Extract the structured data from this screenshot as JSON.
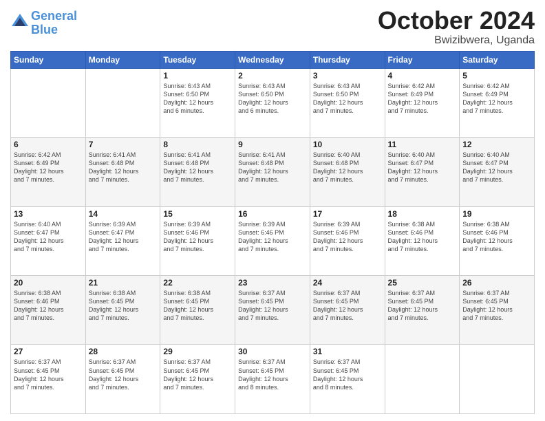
{
  "header": {
    "logo_line1": "General",
    "logo_line2": "Blue",
    "month": "October 2024",
    "location": "Bwizibwera, Uganda"
  },
  "weekdays": [
    "Sunday",
    "Monday",
    "Tuesday",
    "Wednesday",
    "Thursday",
    "Friday",
    "Saturday"
  ],
  "weeks": [
    [
      {
        "day": "",
        "info": ""
      },
      {
        "day": "",
        "info": ""
      },
      {
        "day": "1",
        "info": "Sunrise: 6:43 AM\nSunset: 6:50 PM\nDaylight: 12 hours\nand 6 minutes."
      },
      {
        "day": "2",
        "info": "Sunrise: 6:43 AM\nSunset: 6:50 PM\nDaylight: 12 hours\nand 6 minutes."
      },
      {
        "day": "3",
        "info": "Sunrise: 6:43 AM\nSunset: 6:50 PM\nDaylight: 12 hours\nand 7 minutes."
      },
      {
        "day": "4",
        "info": "Sunrise: 6:42 AM\nSunset: 6:49 PM\nDaylight: 12 hours\nand 7 minutes."
      },
      {
        "day": "5",
        "info": "Sunrise: 6:42 AM\nSunset: 6:49 PM\nDaylight: 12 hours\nand 7 minutes."
      }
    ],
    [
      {
        "day": "6",
        "info": "Sunrise: 6:42 AM\nSunset: 6:49 PM\nDaylight: 12 hours\nand 7 minutes."
      },
      {
        "day": "7",
        "info": "Sunrise: 6:41 AM\nSunset: 6:48 PM\nDaylight: 12 hours\nand 7 minutes."
      },
      {
        "day": "8",
        "info": "Sunrise: 6:41 AM\nSunset: 6:48 PM\nDaylight: 12 hours\nand 7 minutes."
      },
      {
        "day": "9",
        "info": "Sunrise: 6:41 AM\nSunset: 6:48 PM\nDaylight: 12 hours\nand 7 minutes."
      },
      {
        "day": "10",
        "info": "Sunrise: 6:40 AM\nSunset: 6:48 PM\nDaylight: 12 hours\nand 7 minutes."
      },
      {
        "day": "11",
        "info": "Sunrise: 6:40 AM\nSunset: 6:47 PM\nDaylight: 12 hours\nand 7 minutes."
      },
      {
        "day": "12",
        "info": "Sunrise: 6:40 AM\nSunset: 6:47 PM\nDaylight: 12 hours\nand 7 minutes."
      }
    ],
    [
      {
        "day": "13",
        "info": "Sunrise: 6:40 AM\nSunset: 6:47 PM\nDaylight: 12 hours\nand 7 minutes."
      },
      {
        "day": "14",
        "info": "Sunrise: 6:39 AM\nSunset: 6:47 PM\nDaylight: 12 hours\nand 7 minutes."
      },
      {
        "day": "15",
        "info": "Sunrise: 6:39 AM\nSunset: 6:46 PM\nDaylight: 12 hours\nand 7 minutes."
      },
      {
        "day": "16",
        "info": "Sunrise: 6:39 AM\nSunset: 6:46 PM\nDaylight: 12 hours\nand 7 minutes."
      },
      {
        "day": "17",
        "info": "Sunrise: 6:39 AM\nSunset: 6:46 PM\nDaylight: 12 hours\nand 7 minutes."
      },
      {
        "day": "18",
        "info": "Sunrise: 6:38 AM\nSunset: 6:46 PM\nDaylight: 12 hours\nand 7 minutes."
      },
      {
        "day": "19",
        "info": "Sunrise: 6:38 AM\nSunset: 6:46 PM\nDaylight: 12 hours\nand 7 minutes."
      }
    ],
    [
      {
        "day": "20",
        "info": "Sunrise: 6:38 AM\nSunset: 6:46 PM\nDaylight: 12 hours\nand 7 minutes."
      },
      {
        "day": "21",
        "info": "Sunrise: 6:38 AM\nSunset: 6:45 PM\nDaylight: 12 hours\nand 7 minutes."
      },
      {
        "day": "22",
        "info": "Sunrise: 6:38 AM\nSunset: 6:45 PM\nDaylight: 12 hours\nand 7 minutes."
      },
      {
        "day": "23",
        "info": "Sunrise: 6:37 AM\nSunset: 6:45 PM\nDaylight: 12 hours\nand 7 minutes."
      },
      {
        "day": "24",
        "info": "Sunrise: 6:37 AM\nSunset: 6:45 PM\nDaylight: 12 hours\nand 7 minutes."
      },
      {
        "day": "25",
        "info": "Sunrise: 6:37 AM\nSunset: 6:45 PM\nDaylight: 12 hours\nand 7 minutes."
      },
      {
        "day": "26",
        "info": "Sunrise: 6:37 AM\nSunset: 6:45 PM\nDaylight: 12 hours\nand 7 minutes."
      }
    ],
    [
      {
        "day": "27",
        "info": "Sunrise: 6:37 AM\nSunset: 6:45 PM\nDaylight: 12 hours\nand 7 minutes."
      },
      {
        "day": "28",
        "info": "Sunrise: 6:37 AM\nSunset: 6:45 PM\nDaylight: 12 hours\nand 7 minutes."
      },
      {
        "day": "29",
        "info": "Sunrise: 6:37 AM\nSunset: 6:45 PM\nDaylight: 12 hours\nand 7 minutes."
      },
      {
        "day": "30",
        "info": "Sunrise: 6:37 AM\nSunset: 6:45 PM\nDaylight: 12 hours\nand 8 minutes."
      },
      {
        "day": "31",
        "info": "Sunrise: 6:37 AM\nSunset: 6:45 PM\nDaylight: 12 hours\nand 8 minutes."
      },
      {
        "day": "",
        "info": ""
      },
      {
        "day": "",
        "info": ""
      }
    ]
  ]
}
